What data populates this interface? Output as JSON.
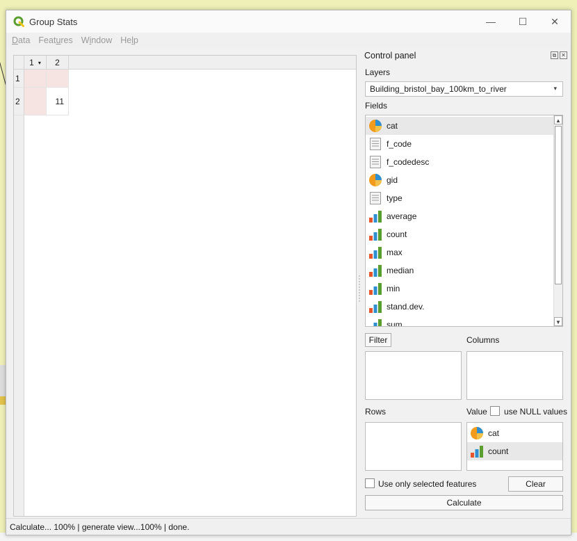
{
  "window": {
    "title": "Group Stats",
    "controls": {
      "minimize": "—",
      "maximize": "☐",
      "close": "✕"
    }
  },
  "menu": [
    {
      "pre": "",
      "u": "D",
      "post": "ata"
    },
    {
      "pre": "Feat",
      "u": "u",
      "post": "res"
    },
    {
      "pre": "W",
      "u": "i",
      "post": "ndow"
    },
    {
      "pre": "He",
      "u": "l",
      "post": "p"
    }
  ],
  "table": {
    "columns": [
      "1",
      "2"
    ],
    "sort_indicator": "▾",
    "rows": [
      {
        "header": "1",
        "cells": [
          "",
          ""
        ]
      },
      {
        "header": "2",
        "cells": [
          "",
          "11"
        ]
      }
    ]
  },
  "control_panel": {
    "title": "Control panel",
    "float_icon": "⧉",
    "close_icon": "✕",
    "layers_label": "Layers",
    "layer_value": "Building_bristol_bay_100km_to_river",
    "combo_arrow": "▾",
    "fields_label": "Fields",
    "fields": [
      {
        "name": "cat",
        "icon": "pie-icon",
        "selected": true
      },
      {
        "name": "f_code",
        "icon": "text-icon"
      },
      {
        "name": "f_codedesc",
        "icon": "text-icon"
      },
      {
        "name": "gid",
        "icon": "pie-icon"
      },
      {
        "name": "type",
        "icon": "text-icon"
      },
      {
        "name": "average",
        "icon": "bar-icon"
      },
      {
        "name": "count",
        "icon": "bar-icon"
      },
      {
        "name": "max",
        "icon": "bar-icon"
      },
      {
        "name": "median",
        "icon": "bar-icon"
      },
      {
        "name": "min",
        "icon": "bar-icon"
      },
      {
        "name": "stand.dev.",
        "icon": "bar-icon"
      },
      {
        "name": "sum",
        "icon": "bar-icon"
      }
    ],
    "scroll_up": "▲",
    "scroll_down": "▼",
    "filter_button": "Filter",
    "columns_label": "Columns",
    "rows_label": "Rows",
    "value_label": "Value",
    "use_null_label": "use NULL values",
    "value_items": [
      {
        "name": "cat",
        "icon": "pie-icon"
      },
      {
        "name": "count",
        "icon": "bar-icon",
        "selected": true
      }
    ],
    "selected_only_label": "Use only selected features",
    "clear_button": "Clear",
    "calculate_button": "Calculate"
  },
  "status": "Calculate... 100% | generate view...100% | done.",
  "colors": {
    "accent_green": "#5a9e2f",
    "pie_orange": "#f29b1c",
    "pie_blue": "#2f8fd1",
    "cell_pink": "#f5e4e2"
  }
}
